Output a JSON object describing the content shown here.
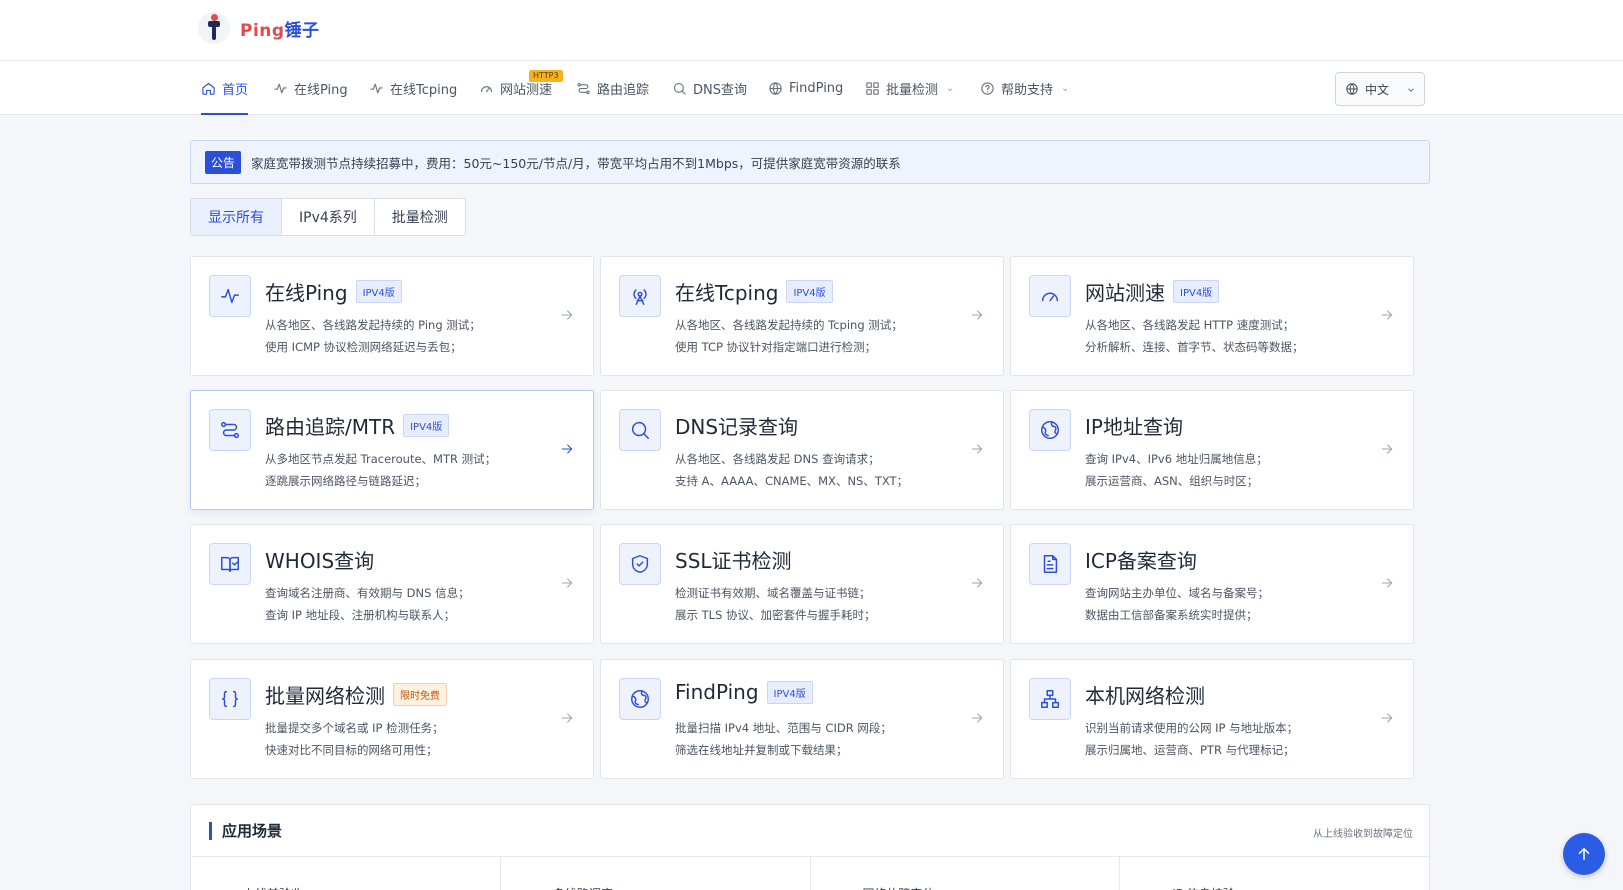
{
  "brand": {
    "name_a": "Ping",
    "name_b": "锤子"
  },
  "nav": {
    "items": [
      {
        "label": "首页",
        "icon": "home-icon"
      },
      {
        "label": "在线Ping",
        "icon": "pulse-icon"
      },
      {
        "label": "在线Tcping",
        "icon": "pulse-icon"
      },
      {
        "label": "网站测速",
        "icon": "speedometer-icon",
        "badge": "HTTP3"
      },
      {
        "label": "路由追踪",
        "icon": "route-icon"
      },
      {
        "label": "DNS查询",
        "icon": "search-icon"
      },
      {
        "label": "FindPing",
        "icon": "globe-icon"
      },
      {
        "label": "批量检测",
        "icon": "grid-icon"
      },
      {
        "label": "帮助支持",
        "icon": "help-icon"
      }
    ],
    "language": "中文"
  },
  "notice": {
    "tag": "公告",
    "text": "家庭宽带拨测节点持续招募中，费用：50元~150元/节点/月，带宽平均占用不到1Mbps，可提供家庭宽带资源的联系"
  },
  "filters": [
    "显示所有",
    "IPv4系列",
    "批量检测"
  ],
  "cards": [
    {
      "title": "在线Ping",
      "badge": "IPV4版",
      "line1": "从各地区、各线路发起持续的 Ping 测试；",
      "line2": "使用 ICMP 协议检测网络延迟与丢包；",
      "icon": "pulse-icon"
    },
    {
      "title": "在线Tcping",
      "badge": "IPV4版",
      "line1": "从各地区、各线路发起持续的 Tcping 测试；",
      "line2": "使用 TCP 协议针对指定端口进行检测；",
      "icon": "antenna-icon"
    },
    {
      "title": "网站测速",
      "badge": "IPV4版",
      "line1": "从各地区、各线路发起 HTTP 速度测试；",
      "line2": "分析解析、连接、首字节、状态码等数据；",
      "icon": "speedometer-icon"
    },
    {
      "title": "路由追踪/MTR",
      "badge": "IPV4版",
      "line1": "从多地区节点发起 Traceroute、MTR 测试；",
      "line2": "逐跳展示网络路径与链路延迟；",
      "icon": "route-icon"
    },
    {
      "title": "DNS记录查询",
      "badge": "",
      "line1": "从各地区、各线路发起 DNS 查询请求；",
      "line2": "支持 A、AAAA、CNAME、MX、NS、TXT；",
      "icon": "search-icon"
    },
    {
      "title": "IP地址查询",
      "badge": "",
      "line1": "查询 IPv4、IPv6 地址归属地信息；",
      "line2": "展示运营商、ASN、组织与时区；",
      "icon": "globe-icon"
    },
    {
      "title": "WHOIS查询",
      "badge": "",
      "line1": "查询域名注册商、有效期与 DNS 信息；",
      "line2": "查询 IP 地址段、注册机构与联系人；",
      "icon": "book-icon"
    },
    {
      "title": "SSL证书检测",
      "badge": "",
      "line1": "检测证书有效期、域名覆盖与证书链；",
      "line2": "展示 TLS 协议、加密套件与握手耗时；",
      "icon": "shield-icon"
    },
    {
      "title": "ICP备案查询",
      "badge": "",
      "line1": "查询网站主办单位、域名与备案号；",
      "line2": "数据由工信部备案系统实时提供；",
      "icon": "document-icon"
    },
    {
      "title": "批量网络检测",
      "badge": "限时免费",
      "line1": "批量提交多个域名或 IP 检测任务；",
      "line2": "快速对比不同目标的网络可用性；",
      "icon": "braces-icon"
    },
    {
      "title": "FindPing",
      "badge": "IPV4版",
      "line1": "批量扫描 IPv4 地址、范围与 CIDR 网段；",
      "line2": "筛选在线地址并复制或下载结果；",
      "icon": "globe-icon"
    },
    {
      "title": "本机网络检测",
      "badge": "",
      "line1": "识别当前请求使用的公网 IP 与地址版本；",
      "line2": "展示归属地、运营商、PTR 与代理标记；",
      "icon": "network-icon"
    }
  ],
  "scenes": {
    "title": "应用场景",
    "subtitle": "从上线验收到故障定位",
    "columns": [
      "上线前验收",
      "多线路调度",
      "网络故障定位",
      "IP 信息核验"
    ]
  },
  "colors": {
    "accent": "#2b4fd8",
    "brand_red": "#e5484d",
    "badge_orange": "#c2570c"
  }
}
